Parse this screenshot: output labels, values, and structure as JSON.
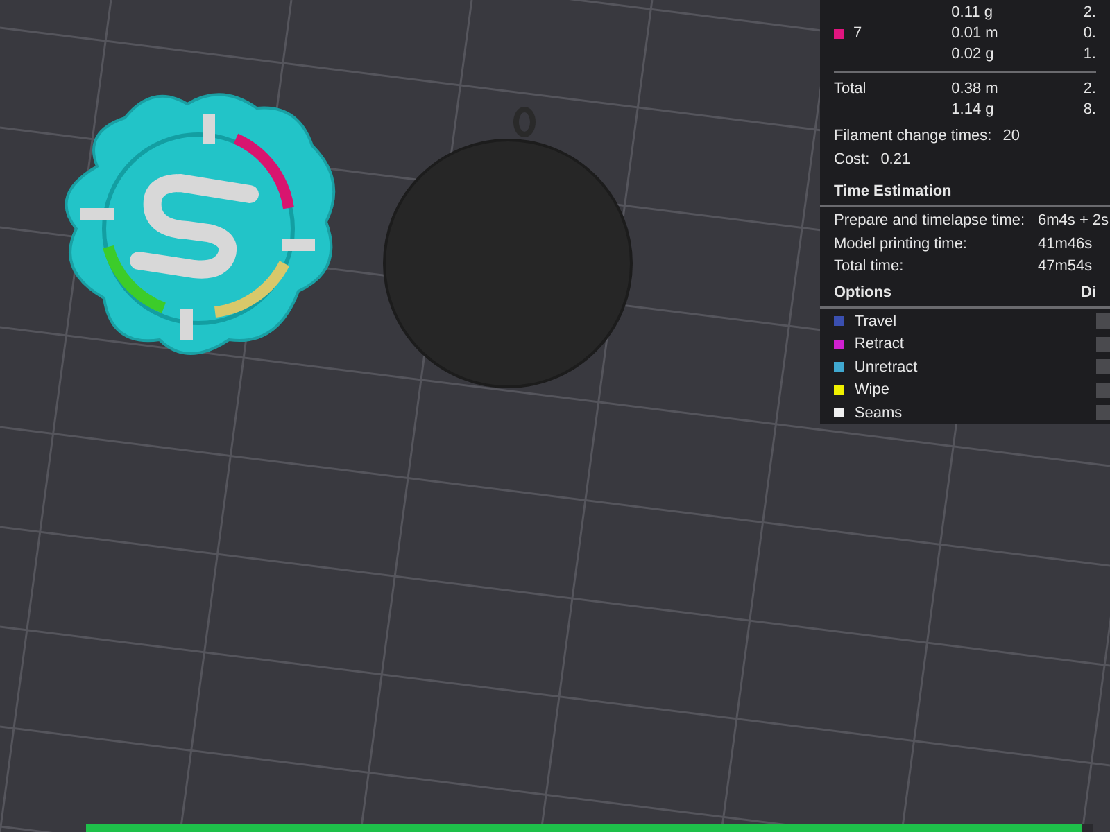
{
  "filament_rows": [
    {
      "label": "",
      "color": "",
      "length": "",
      "weight": "0.11 g",
      "extra_1": "",
      "extra_2": "2."
    },
    {
      "label": "7",
      "color": "#e0157f",
      "length": "0.01 m",
      "weight": "0.02 g",
      "extra_1": "0.",
      "extra_2": "1."
    }
  ],
  "total": {
    "label": "Total",
    "length": "0.38 m",
    "weight": "1.14 g",
    "extra_1": "2.",
    "extra_2": "8."
  },
  "filament_change": {
    "label": "Filament change times:",
    "value": "20"
  },
  "cost": {
    "label": "Cost:",
    "value": "0.21"
  },
  "time_estimation": {
    "title": "Time Estimation",
    "rows": [
      {
        "label": "Prepare and timelapse time:",
        "value": "6m4s + 2s"
      },
      {
        "label": "Model printing time:",
        "value": "41m46s"
      },
      {
        "label": "Total time:",
        "value": "47m54s"
      }
    ]
  },
  "options": {
    "title": "Options",
    "column_2": "Di",
    "items": [
      {
        "label": "Travel",
        "color": "#3a4fb0",
        "checked": false
      },
      {
        "label": "Retract",
        "color": "#d020d0",
        "checked": false
      },
      {
        "label": "Unretract",
        "color": "#40a8d0",
        "checked": false
      },
      {
        "label": "Wipe",
        "color": "#f0f000",
        "checked": false
      },
      {
        "label": "Seams",
        "color": "#f0f0f0",
        "checked": false
      }
    ]
  },
  "layer_slider": {
    "level": 1
  }
}
